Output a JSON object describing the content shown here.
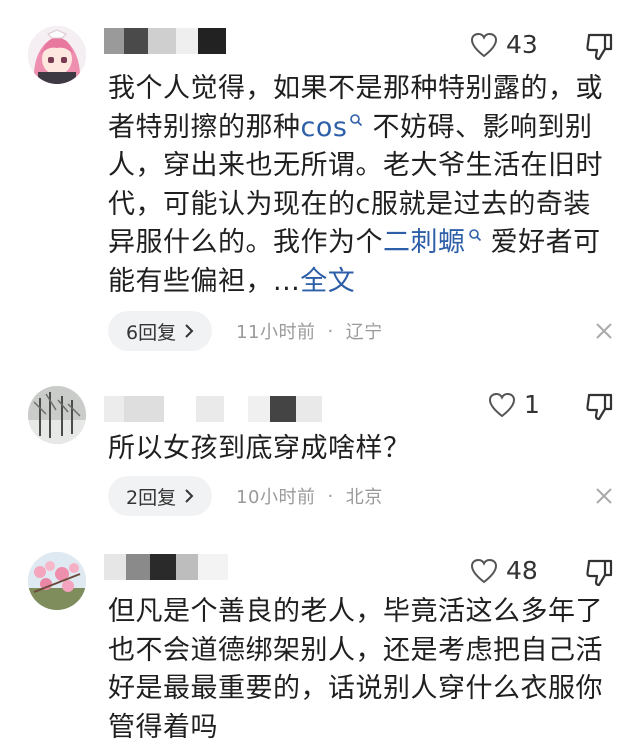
{
  "comments": [
    {
      "likes": "43",
      "text_parts": [
        "我个人觉得，如果不是那种特别露的，或者特别擦的那种",
        "cos",
        " 不妨碍、影响到别人，穿出来也无所谓。老大爷生活在旧时代，可能认为现在的c服就是过去的奇装异服什么的。我作为个",
        "二刺螈",
        " 爱好者可能有些偏袒，...",
        "全文"
      ],
      "reply_label": "6回复",
      "time": "11小时前",
      "separator": "·",
      "location": "辽宁"
    },
    {
      "likes": "1",
      "text": "所以女孩到底穿成啥样？",
      "reply_label": "2回复",
      "time": "10小时前",
      "separator": "·",
      "location": "北京"
    },
    {
      "likes": "48",
      "text": "但凡是个善良的老人，毕竟活这么多年了也不会道德绑架别人，还是考虑把自己活好是最最重要的，话说别人穿什么衣服你管得着吗"
    }
  ],
  "icons": {
    "like": "heart-outline-icon",
    "dislike": "thumbs-down-icon",
    "reply_arrow": "chevron-right-icon",
    "close": "close-icon",
    "link_search": "search-icon"
  },
  "colors": {
    "link": "#2d5fa8",
    "meta": "#9a9a9a",
    "pill_bg": "#f1f2f4"
  }
}
